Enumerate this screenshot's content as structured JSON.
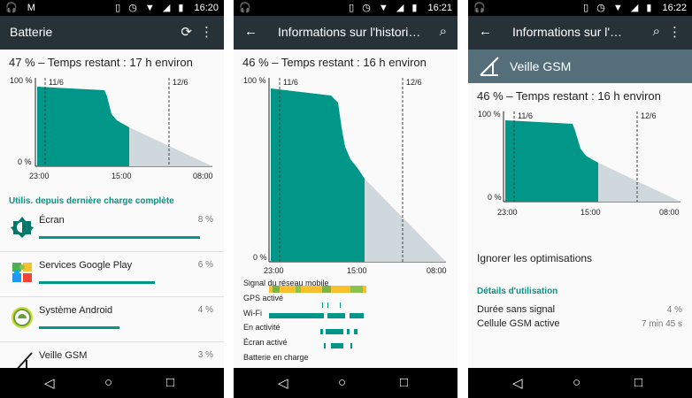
{
  "status_bar": [
    {
      "time": "16:20"
    },
    {
      "time": "16:21"
    },
    {
      "time": "16:22"
    }
  ],
  "panel1": {
    "title": "Batterie",
    "summary": "47 % – Temps restant : 17 h environ",
    "chart": {
      "y_top": "100 %",
      "y_bottom": "0 %",
      "day1": "11/6",
      "day2": "12/6",
      "x_labels": [
        "23:00",
        "15:00",
        "08:00"
      ]
    },
    "section_header": "Utilis. depuis dernière charge complète",
    "usage": [
      {
        "name": "Écran",
        "pct": "8 %",
        "value": 8,
        "icon": "brightness-icon"
      },
      {
        "name": "Services Google Play",
        "pct": "6 %",
        "value": 6,
        "icon": "puzzle-icon"
      },
      {
        "name": "Système Android",
        "pct": "4 %",
        "value": 4,
        "icon": "android-icon"
      },
      {
        "name": "Veille GSM",
        "pct": "3 %",
        "value": 3,
        "icon": "signal-icon"
      }
    ]
  },
  "panel2": {
    "title": "Informations sur l'histori…",
    "summary": "46 % – Temps restant : 16 h environ",
    "chart": {
      "y_top": "100 %",
      "y_bottom": "0 %",
      "day1": "11/6",
      "day2": "12/6",
      "x_labels": [
        "23:00",
        "15:00",
        "08:00"
      ]
    },
    "history": [
      {
        "label": "Signal du réseau mobile"
      },
      {
        "label": "GPS activé"
      },
      {
        "label": "Wi-Fi"
      },
      {
        "label": "En activité"
      },
      {
        "label": "Écran activé"
      },
      {
        "label": "Batterie en charge"
      }
    ]
  },
  "panel3": {
    "title": "Informations sur l'…",
    "banner_title": "Veille GSM",
    "summary": "46 % – Temps restant : 16 h environ",
    "chart": {
      "y_top": "100 %",
      "y_bottom": "0 %",
      "day1": "11/6",
      "day2": "12/6",
      "x_labels": [
        "23:00",
        "15:00",
        "08:00"
      ]
    },
    "ignore_label": "Ignorer les optimisations",
    "details_header": "Détails d'utilisation",
    "details": [
      {
        "label": "Durée sans signal",
        "value": "4 %"
      },
      {
        "label": "Cellule GSM active",
        "value": "7 min 45 s"
      }
    ]
  },
  "colors": {
    "accent": "#009688",
    "toolbar": "#263238",
    "banner": "#546e7a",
    "projection": "#cfd8dc"
  }
}
